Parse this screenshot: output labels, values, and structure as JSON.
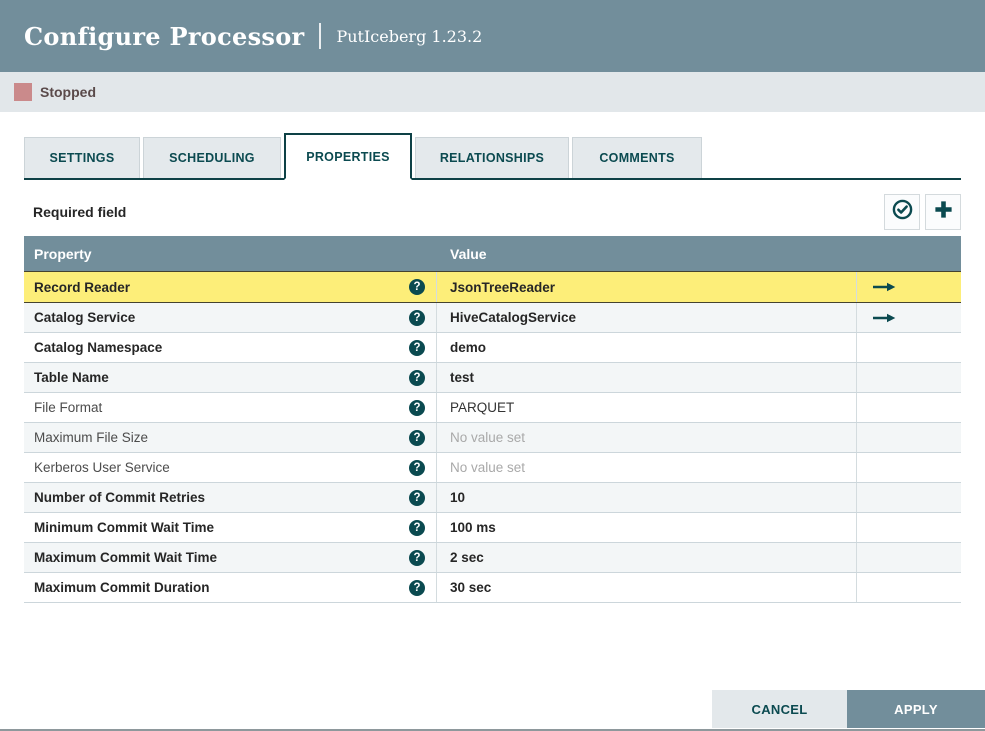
{
  "header": {
    "title": "Configure Processor",
    "subtitle": "PutIceberg 1.23.2"
  },
  "status": {
    "label": "Stopped",
    "color": "#ca8a8b"
  },
  "tabs": [
    {
      "label": "SETTINGS",
      "active": false
    },
    {
      "label": "SCHEDULING",
      "active": false
    },
    {
      "label": "PROPERTIES",
      "active": true
    },
    {
      "label": "RELATIONSHIPS",
      "active": false
    },
    {
      "label": "COMMENTS",
      "active": false
    }
  ],
  "toolbar": {
    "required_label": "Required field",
    "verify_icon": "verify-properties-check-circle-icon",
    "add_icon": "add-property-plus-icon"
  },
  "table": {
    "columns": [
      "Property",
      "Value"
    ],
    "rows": [
      {
        "property": "Record Reader",
        "value": "JsonTreeReader",
        "required": true,
        "empty": false,
        "selected": true,
        "link": true
      },
      {
        "property": "Catalog Service",
        "value": "HiveCatalogService",
        "required": true,
        "empty": false,
        "selected": false,
        "link": true
      },
      {
        "property": "Catalog Namespace",
        "value": "demo",
        "required": true,
        "empty": false,
        "selected": false,
        "link": false
      },
      {
        "property": "Table Name",
        "value": "test",
        "required": true,
        "empty": false,
        "selected": false,
        "link": false
      },
      {
        "property": "File Format",
        "value": "PARQUET",
        "required": false,
        "empty": false,
        "selected": false,
        "link": false
      },
      {
        "property": "Maximum File Size",
        "value": "No value set",
        "required": false,
        "empty": true,
        "selected": false,
        "link": false
      },
      {
        "property": "Kerberos User Service",
        "value": "No value set",
        "required": false,
        "empty": true,
        "selected": false,
        "link": false
      },
      {
        "property": "Number of Commit Retries",
        "value": "10",
        "required": true,
        "empty": false,
        "selected": false,
        "link": false
      },
      {
        "property": "Minimum Commit Wait Time",
        "value": "100 ms",
        "required": true,
        "empty": false,
        "selected": false,
        "link": false
      },
      {
        "property": "Maximum Commit Wait Time",
        "value": "2 sec",
        "required": true,
        "empty": false,
        "selected": false,
        "link": false
      },
      {
        "property": "Maximum Commit Duration",
        "value": "30 sec",
        "required": true,
        "empty": false,
        "selected": false,
        "link": false
      }
    ]
  },
  "footer": {
    "cancel_label": "CANCEL",
    "apply_label": "APPLY"
  },
  "colors": {
    "header_bg": "#728e9b",
    "accent_teal": "#0b4a50",
    "selected_row_bg": "#fdee79",
    "status_bar_bg": "#e2e7ea",
    "empty_value_text": "#a9a9a9"
  }
}
